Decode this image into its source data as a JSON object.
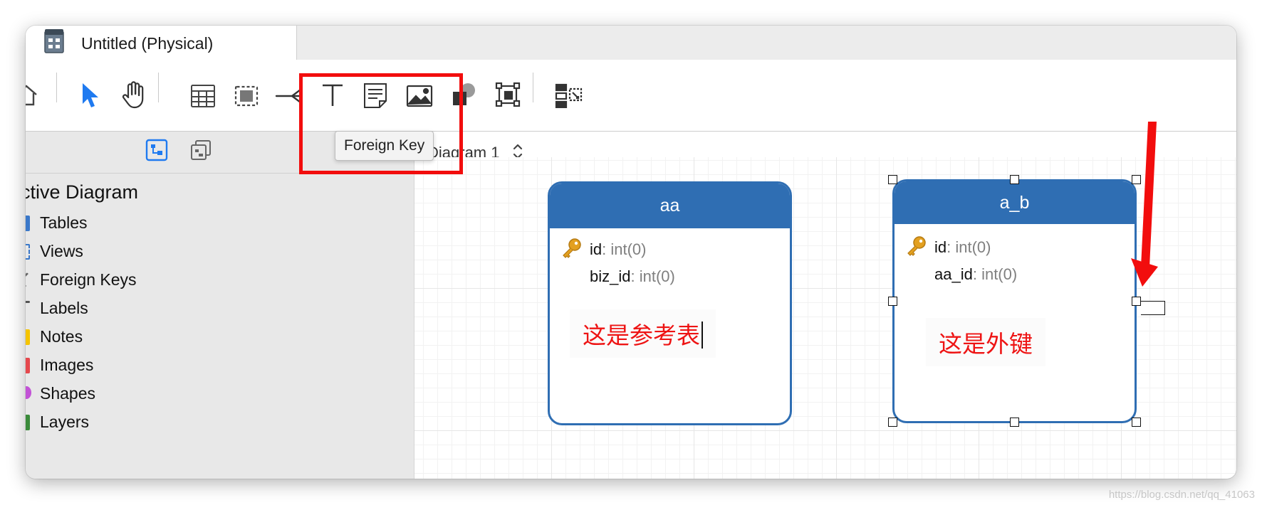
{
  "window": {
    "tab_title": "Untitled (Physical)"
  },
  "toolbar": {
    "tooltip": "Foreign Key",
    "tools": [
      "home-icon",
      "pointer-icon",
      "hand-icon",
      "table-icon",
      "view-icon",
      "foreign-key-icon",
      "text-icon",
      "note-icon",
      "image-icon",
      "shape-icon",
      "layer-icon",
      "auto-layout-icon"
    ]
  },
  "sidebar": {
    "section_title": "ctive Diagram",
    "items": [
      {
        "label": "Tables",
        "color": "#3a78c9"
      },
      {
        "label": "Views",
        "color": "#3a78c9"
      },
      {
        "label": "Foreign Keys",
        "color": "#666666"
      },
      {
        "label": "Labels",
        "color": "#555555"
      },
      {
        "label": "Notes",
        "color": "#f5c400"
      },
      {
        "label": "Images",
        "color": "#e5484d"
      },
      {
        "label": "Shapes",
        "color": "#c252d6"
      },
      {
        "label": "Layers",
        "color": "#3a8a3a"
      }
    ]
  },
  "diagram": {
    "selector_label": "Diagram 1",
    "entities": [
      {
        "name": "aa",
        "fields": [
          {
            "name": "id",
            "type": ": int(0)",
            "primary_key": true
          },
          {
            "name": "biz_id",
            "type": ": int(0)",
            "primary_key": false
          }
        ],
        "note": "这是参考表"
      },
      {
        "name": "a_b",
        "fields": [
          {
            "name": "id",
            "type": ": int(0)",
            "primary_key": true
          },
          {
            "name": "aa_id",
            "type": ": int(0)",
            "primary_key": false
          }
        ],
        "note": "这是外键"
      }
    ]
  },
  "colors": {
    "accent": "#2f6eb3",
    "highlight": "#f20d0d",
    "note_text": "#ee1414"
  },
  "watermark": "https://blog.csdn.net/qq_41063"
}
